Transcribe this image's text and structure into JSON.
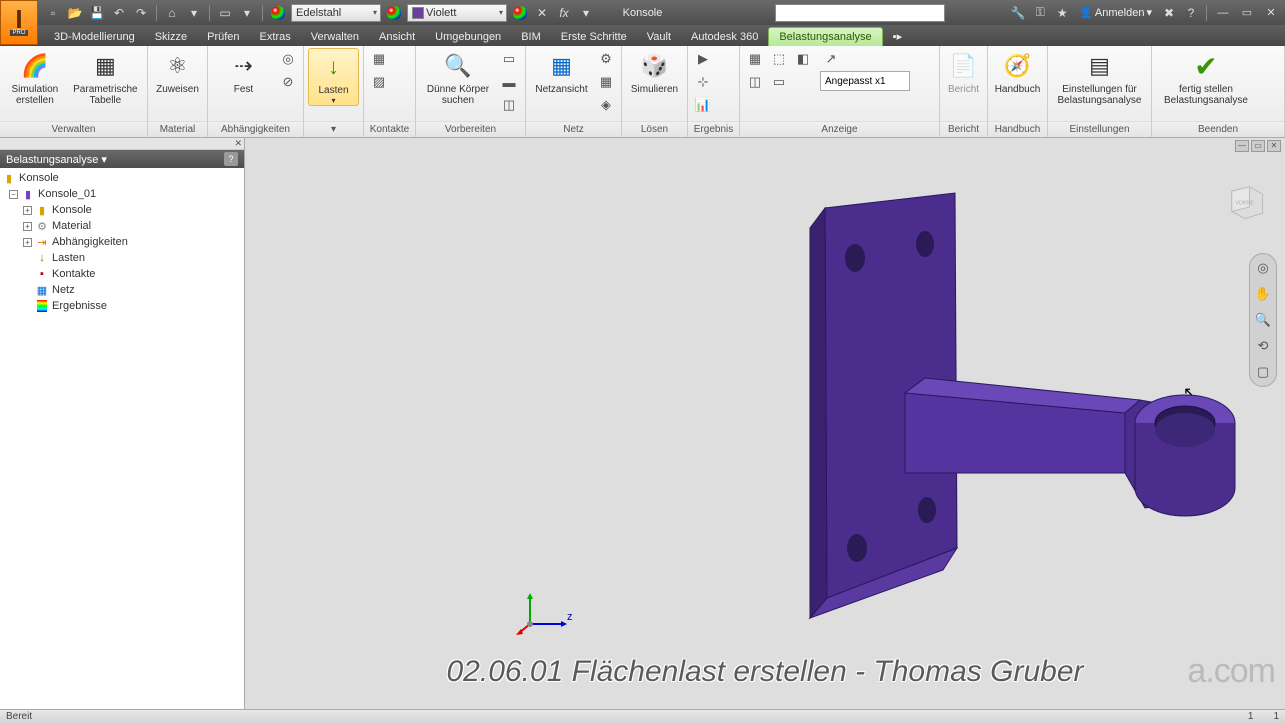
{
  "app": {
    "pro_label": "PRO"
  },
  "titlebar": {
    "material_dd": "Edelstahl",
    "appearance_dd": "Violett",
    "doc_title": "Konsole",
    "login": "Anmelden"
  },
  "tabs": {
    "t0": "3D-Modellierung",
    "t1": "Skizze",
    "t2": "Prüfen",
    "t3": "Extras",
    "t4": "Verwalten",
    "t5": "Ansicht",
    "t6": "Umgebungen",
    "t7": "BIM",
    "t8": "Erste Schritte",
    "t9": "Vault",
    "t10": "Autodesk 360",
    "t11": "Belastungsanalyse"
  },
  "ribbon": {
    "verwalten": {
      "label": "Verwalten",
      "sim_create": "Simulation erstellen",
      "param_table": "Parametrische Tabelle"
    },
    "material": {
      "label": "Material",
      "zuweisen": "Zuweisen"
    },
    "abhaeng": {
      "label": "Abhängigkeiten",
      "fest": "Fest"
    },
    "lasten": {
      "label": "Lasten",
      "dd": "▾"
    },
    "kontakte": {
      "label": "Kontakte"
    },
    "vorbereiten": {
      "label": "Vorbereiten",
      "duenn": "Dünne Körper suchen"
    },
    "netz": {
      "label": "Netz",
      "netzansicht": "Netzansicht"
    },
    "loesen": {
      "label": "Lösen",
      "simulieren": "Simulieren"
    },
    "ergebnis": {
      "label": "Ergebnis"
    },
    "anzeige": {
      "label": "Anzeige",
      "zoom": "Angepasst x1"
    },
    "bericht": {
      "label": "Bericht",
      "btn": "Bericht"
    },
    "handbuch": {
      "label": "Handbuch",
      "btn": "Handbuch"
    },
    "einstellungen": {
      "label": "Einstellungen",
      "btn": "Einstellungen für Belastungsanalyse"
    },
    "beenden": {
      "label": "Beenden",
      "btn": "fertig stellen Belastungsanalyse"
    }
  },
  "browser": {
    "title": "Belastungsanalyse ▾",
    "root": "Konsole",
    "n1": "Konsole_01",
    "n2": "Konsole",
    "n3": "Material",
    "n4": "Abhängigkeiten",
    "n5": "Lasten",
    "n6": "Kontakte",
    "n7": "Netz",
    "n8": "Ergebnisse"
  },
  "viewcube": {
    "face": "VORNE"
  },
  "axis": {
    "z": "z"
  },
  "caption": "02.06.01 Flächenlast erstellen - Thomas Gruber",
  "watermark": "a.com",
  "status": {
    "ready": "Bereit",
    "n1": "1",
    "n2": "1"
  }
}
